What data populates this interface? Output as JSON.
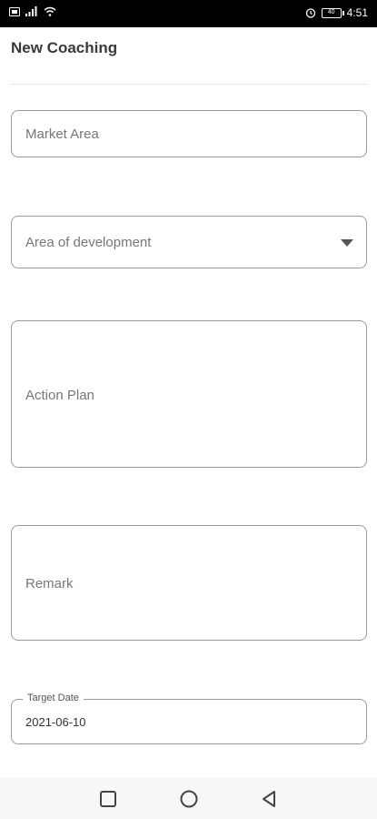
{
  "status_bar": {
    "time": "4:51",
    "battery_level": "40",
    "icons": [
      "sim-icon",
      "signal-icon",
      "wifi-icon",
      "alarm-icon",
      "battery-icon"
    ]
  },
  "header": {
    "title": "New Coaching"
  },
  "form": {
    "market_area_placeholder": "Market Area",
    "area_of_development_placeholder": "Area of development",
    "action_plan_placeholder": "Action Plan",
    "remark_placeholder": "Remark",
    "target_date_label": "Target Date",
    "target_date_value": "2021-06-10"
  },
  "nav": {
    "icons": [
      "recents-square-icon",
      "home-circle-icon",
      "back-triangle-icon"
    ]
  }
}
